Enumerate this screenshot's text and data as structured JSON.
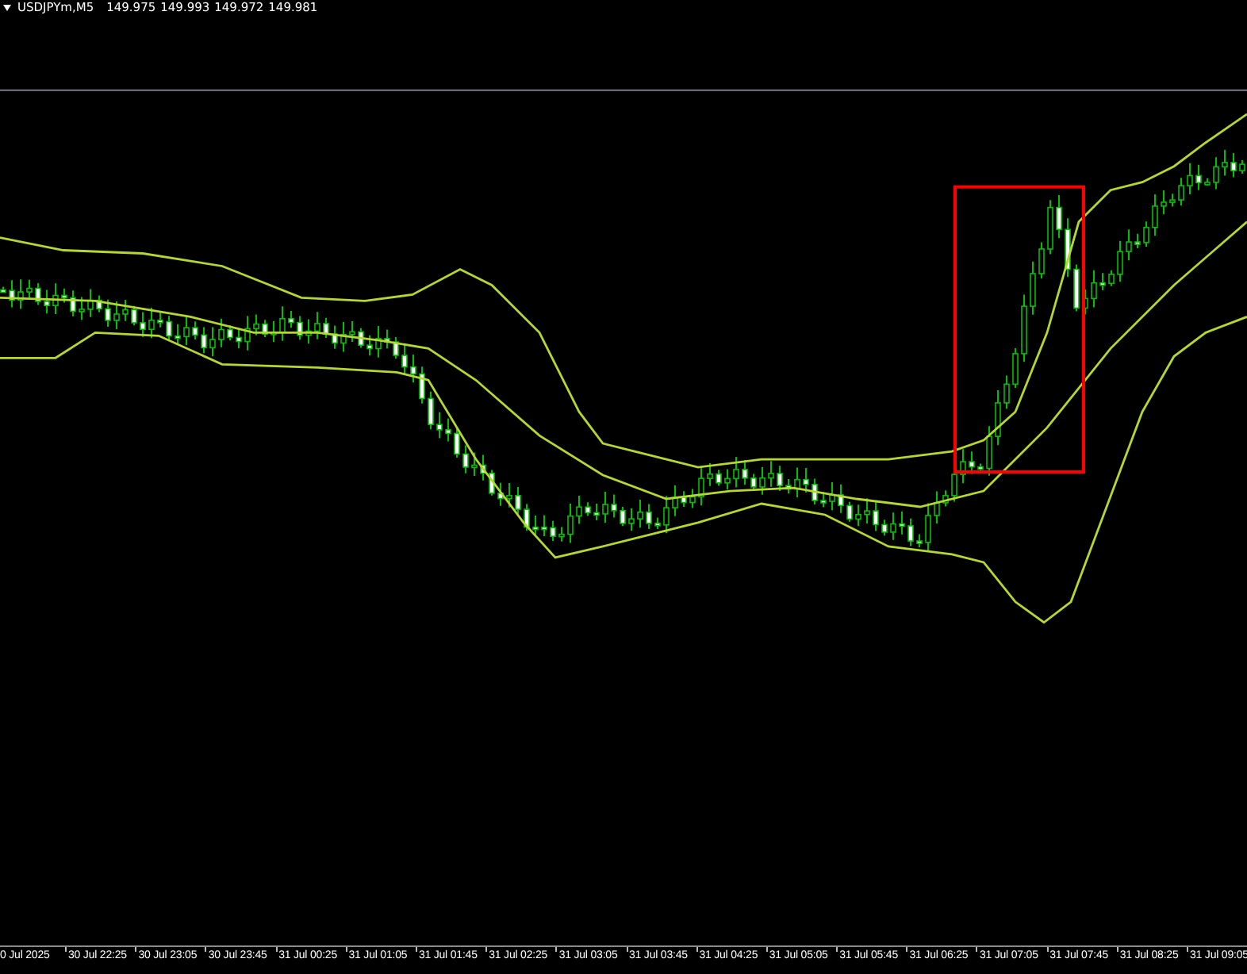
{
  "header": {
    "symbol": "USDJPYm,M5",
    "values": [
      "149.975",
      "149.993",
      "149.972",
      "149.981"
    ]
  },
  "time_axis": {
    "labels": [
      "0 Jul 2025",
      "30 Jul 22:25",
      "30 Jul 23:05",
      "30 Jul 23:45",
      "31 Jul 00:25",
      "31 Jul 01:05",
      "31 Jul 01:45",
      "31 Jul 02:25",
      "31 Jul 03:05",
      "31 Jul 03:45",
      "31 Jul 04:25",
      "31 Jul 05:05",
      "31 Jul 05:45",
      "31 Jul 06:25",
      "31 Jul 07:05",
      "31 Jul 07:45",
      "31 Jul 08:25",
      "31 Jul 09:05"
    ]
  }
}
